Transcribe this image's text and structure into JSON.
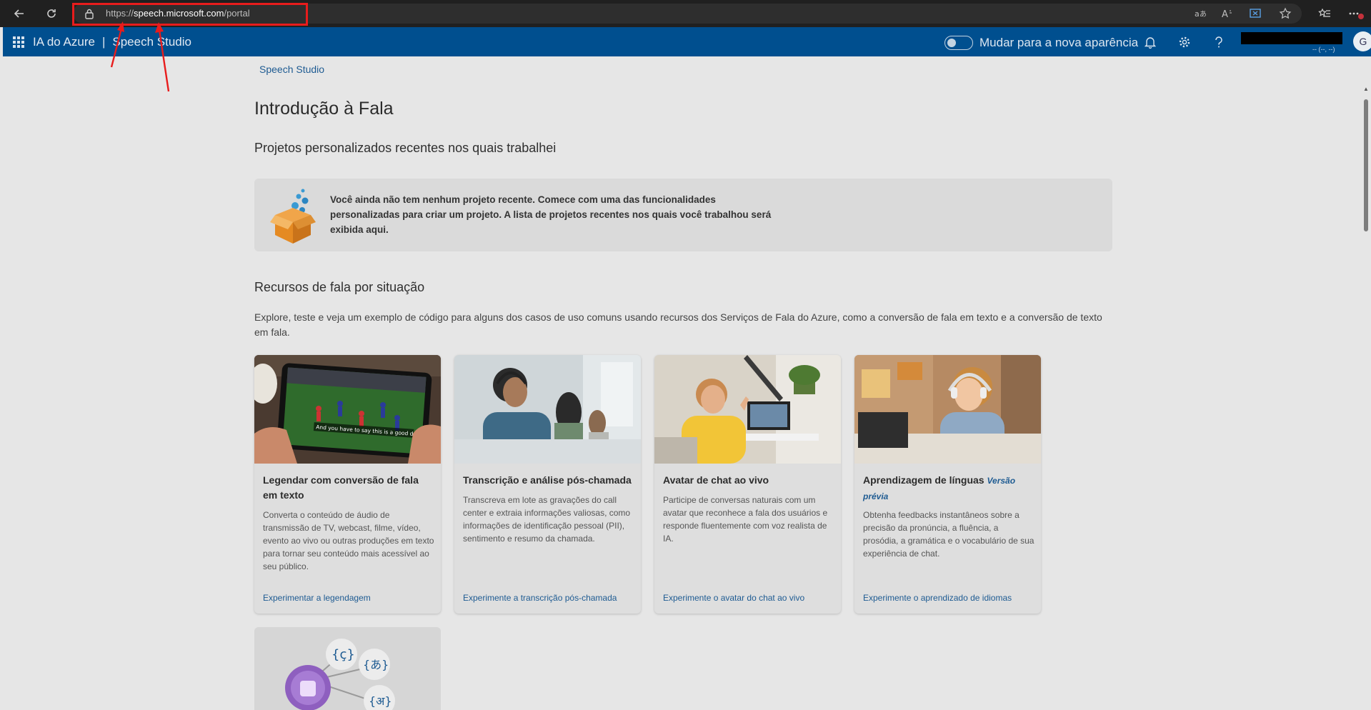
{
  "browser": {
    "url_scheme": "https://",
    "url_host": "speech.microsoft.com",
    "url_path": "/portal"
  },
  "app_header": {
    "brand": "IA do Azure",
    "separator": "|",
    "product": "Speech Studio",
    "toggle_label": "Mudar para a nova aparência",
    "account_sub": "-- (--, --)",
    "avatar_initial": "G"
  },
  "page": {
    "breadcrumb": "Speech Studio",
    "title": "Introdução à Fala",
    "recent_heading": "Projetos personalizados recentes nos quais trabalhei",
    "recent_empty": "Você ainda não tem nenhum projeto recente. Comece com uma das funcionalidades personalizadas para criar um projeto. A lista de projetos recentes nos quais você trabalhou será exibida aqui.",
    "scenarios_heading": "Recursos de fala por situação",
    "scenarios_description": "Explore, teste e veja um exemplo de código para alguns dos casos de uso comuns usando recursos dos Serviços de Fala do Azure, como a conversão de fala em texto e a conversão de texto em fala."
  },
  "cards": [
    {
      "title": "Legendar com conversão de fala em texto",
      "badge": "",
      "description": "Converta o conteúdo de áudio de transmissão de TV, webcast, filme, vídeo, evento ao vivo ou outras produções em texto para tornar seu conteúdo mais acessível ao seu público.",
      "link": "Experimentar a legendagem",
      "image_caption": "And you have to say this is a good defense."
    },
    {
      "title": "Transcrição e análise pós-chamada",
      "badge": "",
      "description": "Transcreva em lote as gravações do call center e extraia informações valiosas, como informações de identificação pessoal (PII), sentimento e resumo da chamada.",
      "link": "Experimente a transcrição pós-chamada"
    },
    {
      "title": "Avatar de chat ao vivo",
      "badge": "",
      "description": "Participe de conversas naturais com um avatar que reconhece a fala dos usuários e responde fluentemente com voz realista de IA.",
      "link": "Experimente o avatar do chat ao vivo"
    },
    {
      "title": "Aprendizagem de línguas",
      "badge": "Versão prévia",
      "description": "Obtenha feedbacks instantâneos sobre a precisão da pronúncia, a fluência, a prosódia, a gramática e o vocabulário de sua experiência de chat.",
      "link": "Experimente o aprendizado de idiomas"
    }
  ],
  "language_card": {
    "glyphs": [
      "{ç}",
      "{あ}",
      "{अ}"
    ]
  },
  "colors": {
    "header_bg": "#004f8f",
    "link": "#1e5b92",
    "annotation": "#e81c1c"
  }
}
